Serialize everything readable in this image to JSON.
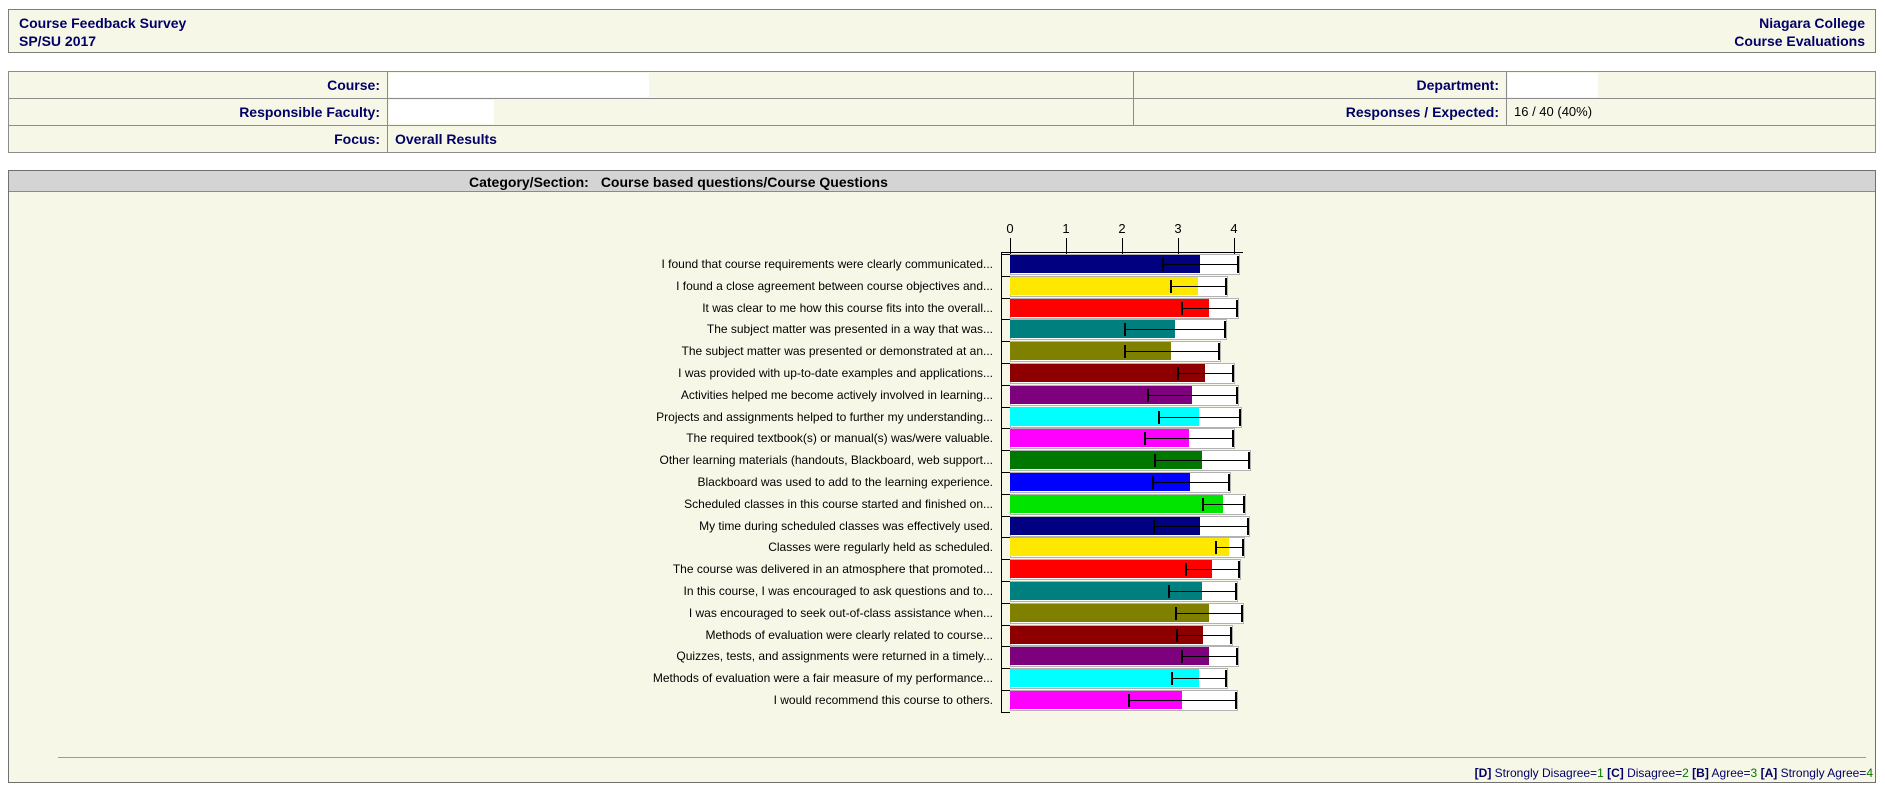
{
  "header": {
    "title": "Course Feedback Survey",
    "term": "SP/SU 2017",
    "org_line1": "Niagara College",
    "org_line2": "Course Evaluations"
  },
  "info": {
    "course_label": "Course:",
    "course_value": "",
    "department_label": "Department:",
    "department_value": "",
    "faculty_label": "Responsible Faculty:",
    "faculty_value": "",
    "responses_label": "Responses / Expected:",
    "responses_value": "16 / 40 (40%)",
    "focus_label": "Focus:",
    "focus_value": "Overall Results"
  },
  "section": {
    "label": "Category/Section:",
    "value": "Course based questions/Course Questions"
  },
  "chart_data": {
    "type": "bar",
    "orientation": "horizontal",
    "title": "Category/Section: Course based questions/Course Questions",
    "xlabel": "",
    "ylabel": "",
    "xlim": [
      0,
      4
    ],
    "xticks": [
      0,
      1,
      2,
      3,
      4
    ],
    "grid": false,
    "error_bars": true,
    "items": [
      {
        "label": "I found that course requirements were clearly communicated...",
        "value": 3.39,
        "err": 0.68,
        "color": "#000080"
      },
      {
        "label": "I found a close agreement between course objectives and...",
        "value": 3.36,
        "err": 0.5,
        "color": "#ffe800"
      },
      {
        "label": "It was clear to me how this course fits into the overall...",
        "value": 3.56,
        "err": 0.5,
        "color": "#ff0000"
      },
      {
        "label": "The subject matter was presented in a way that was...",
        "value": 2.94,
        "err": 0.9,
        "color": "#007f7f"
      },
      {
        "label": "The subject matter was presented or demonstrated at an...",
        "value": 2.88,
        "err": 0.85,
        "color": "#7f7f00"
      },
      {
        "label": "I was provided with up-to-date examples and applications...",
        "value": 3.48,
        "err": 0.5,
        "color": "#8e0000"
      },
      {
        "label": "Activities helped me become actively involved in learning...",
        "value": 3.25,
        "err": 0.81,
        "color": "#7d007d"
      },
      {
        "label": "Projects and assignments helped to further my understanding...",
        "value": 3.38,
        "err": 0.73,
        "color": "#00ffff"
      },
      {
        "label": "The required textbook(s) or manual(s) was/were valuable.",
        "value": 3.19,
        "err": 0.8,
        "color": "#ff00ff"
      },
      {
        "label": "Other learning materials (handouts, Blackboard, web support...",
        "value": 3.42,
        "err": 0.85,
        "color": "#007800"
      },
      {
        "label": "Blackboard was used to add to the learning experience.",
        "value": 3.22,
        "err": 0.69,
        "color": "#0000ff"
      },
      {
        "label": "Scheduled classes in this course started and finished on...",
        "value": 3.8,
        "err": 0.38,
        "color": "#00e400"
      },
      {
        "label": "My time during scheduled classes was effectively used.",
        "value": 3.4,
        "err": 0.85,
        "color": "#000080"
      },
      {
        "label": "Classes were regularly held as scheduled.",
        "value": 3.91,
        "err": 0.25,
        "color": "#ffe800"
      },
      {
        "label": "The course was delivered in an atmosphere that promoted...",
        "value": 3.61,
        "err": 0.48,
        "color": "#ff0000"
      },
      {
        "label": "In this course, I was encouraged to ask questions and to...",
        "value": 3.43,
        "err": 0.6,
        "color": "#007f7f"
      },
      {
        "label": "I was encouraged to seek out-of-class assistance when...",
        "value": 3.55,
        "err": 0.6,
        "color": "#7f7f00"
      },
      {
        "label": "Methods of evaluation were clearly related to course...",
        "value": 3.45,
        "err": 0.49,
        "color": "#8e0000"
      },
      {
        "label": "Quizzes, tests, and assignments were returned in a timely...",
        "value": 3.55,
        "err": 0.5,
        "color": "#7d007d"
      },
      {
        "label": "Methods of evaluation were a fair measure of my performance...",
        "value": 3.37,
        "err": 0.49,
        "color": "#00ffff"
      },
      {
        "label": "I would recommend this course to others.",
        "value": 3.07,
        "err": 0.97,
        "color": "#ff00ff"
      }
    ]
  },
  "footer": {
    "legend": [
      {
        "tag": "[D]",
        "text": "Strongly Disagree",
        "num": "1"
      },
      {
        "tag": "[C]",
        "text": "Disagree",
        "num": "2"
      },
      {
        "tag": "[B]",
        "text": "Agree",
        "num": "3"
      },
      {
        "tag": "[A]",
        "text": "Strongly Agree",
        "num": "4"
      }
    ]
  }
}
